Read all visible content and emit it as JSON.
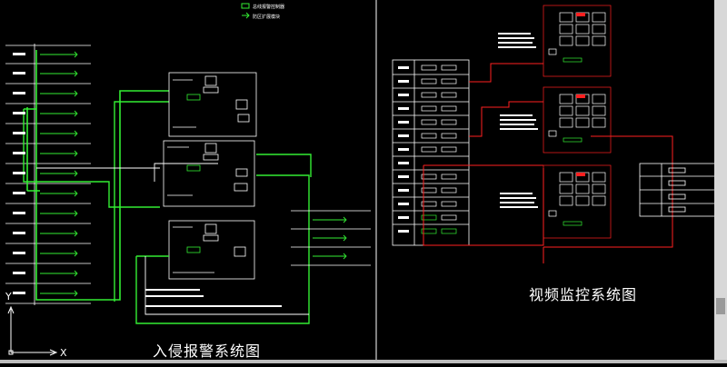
{
  "titles": {
    "left": "入侵报警系统图",
    "right": "视频监控系统图"
  },
  "legend": {
    "item1": "总线报警控制器",
    "item2": "防区扩展模块"
  },
  "ucs": {
    "x": "X",
    "y": "Y"
  },
  "colors": {
    "background": "#000000",
    "wire_green": "#33ee33",
    "line_white": "#ffffff",
    "line_red": "#ff2020",
    "text_white": "#ffffff"
  }
}
